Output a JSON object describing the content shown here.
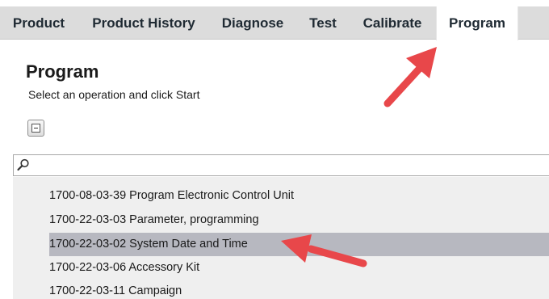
{
  "tabs": [
    {
      "label": "Product"
    },
    {
      "label": "Product History"
    },
    {
      "label": "Diagnose"
    },
    {
      "label": "Test"
    },
    {
      "label": "Calibrate"
    },
    {
      "label": "Program",
      "active": true
    }
  ],
  "header": {
    "title": "Program",
    "subtitle": "Select an operation and click Start"
  },
  "search": {
    "value": "",
    "placeholder": ""
  },
  "operations": [
    {
      "label": "1700-08-03-39 Program Electronic Control Unit"
    },
    {
      "label": "1700-22-03-03 Parameter, programming"
    },
    {
      "label": "1700-22-03-02 System Date and Time",
      "selected": true
    },
    {
      "label": "1700-22-03-06 Accessory Kit"
    },
    {
      "label": "1700-22-03-11 Campaign"
    }
  ],
  "colors": {
    "annotation_arrow": "#e8474a",
    "selected_row": "#b7b8c0",
    "tab_bar": "#dcdcdc"
  },
  "icons": {
    "collapse": "collapse-icon",
    "search": "search-icon"
  }
}
